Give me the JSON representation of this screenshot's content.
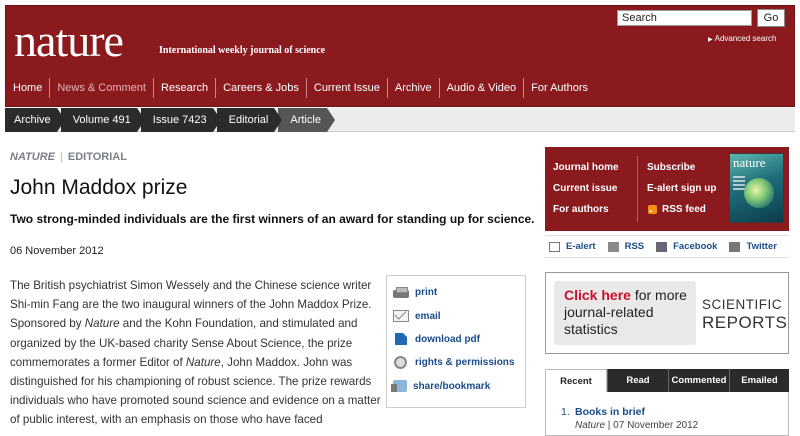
{
  "header": {
    "logo": "nature",
    "tagline": "International weekly journal of science",
    "search_placeholder": "Search",
    "go_label": "Go",
    "advanced_search": "Advanced search",
    "nav": [
      "Home",
      "News & Comment",
      "Research",
      "Careers & Jobs",
      "Current Issue",
      "Archive",
      "Audio & Video",
      "For Authors"
    ]
  },
  "breadcrumb": [
    "Archive",
    "Volume 491",
    "Issue 7423",
    "Editorial",
    "Article"
  ],
  "article": {
    "journal": "NATURE",
    "section": "EDITORIAL",
    "title": "John Maddox prize",
    "standfirst": "Two strong-minded individuals are the first winners of an award for standing up for science.",
    "date": "06 November 2012",
    "body": [
      {
        "t": "The British psychiatrist Simon Wessely and the Chinese science writer Shi-min Fang are the two inaugural winners of the John Maddox Prize. Sponsored by "
      },
      {
        "em": "Nature"
      },
      {
        "t": " and the Kohn Foundation, and stimulated and organized by the UK-based charity Sense About Science, the prize commemorates a former Editor of "
      },
      {
        "em": "Nature"
      },
      {
        "t": ", John Maddox. John was distinguished for his championing of robust science. The prize rewards individuals who have promoted sound science and evidence on a matter of public interest, with an emphasis on those who have faced"
      }
    ]
  },
  "tools": [
    "print",
    "email",
    "download pdf",
    "rights & permissions",
    "share/bookmark"
  ],
  "journal_box": {
    "left": [
      "Journal home",
      "Current issue",
      "For authors"
    ],
    "right": [
      "Subscribe",
      "E-alert sign up",
      "RSS feed"
    ],
    "cover_title": "nature"
  },
  "social": [
    "E-alert",
    "RSS",
    "Facebook",
    "Twitter"
  ],
  "ad": {
    "click_here": "Click here",
    "click_rest": " for more journal-related statistics",
    "brand_line1": "SCIENTIFIC",
    "brand_line2": "REPORTS"
  },
  "tabs": [
    "Recent",
    "Read",
    "Commented",
    "Emailed"
  ],
  "recent": {
    "num": "1.",
    "title": "Books in brief",
    "journal": "Nature",
    "date": " | 07 November 2012"
  },
  "colors": {
    "brand_red": "#8b1a1f",
    "link_blue": "#1a4d8a"
  }
}
